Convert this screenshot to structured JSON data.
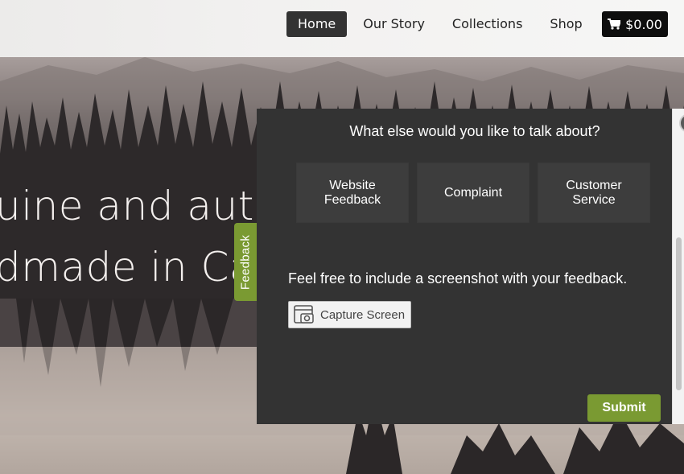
{
  "nav": {
    "items": [
      {
        "label": "Home",
        "active": true
      },
      {
        "label": "Our Story",
        "active": false
      },
      {
        "label": "Collections",
        "active": false
      },
      {
        "label": "Shop",
        "active": false
      }
    ],
    "cart": {
      "icon": "cart-icon",
      "total": "$0.00"
    }
  },
  "hero": {
    "line1": "uine and authe",
    "line2": "dmade in Cal"
  },
  "feedback_tab": {
    "label": "Feedback",
    "color": "#7a9a32"
  },
  "panel": {
    "question": "What else would you like to talk about?",
    "topics": [
      {
        "label": "Website\nFeedback"
      },
      {
        "label": "Complaint"
      },
      {
        "label": "Customer\nService"
      }
    ],
    "screenshot_hint": "Feel free to include a screenshot with your feedback.",
    "capture_label": "Capture Screen",
    "capture_icon": "camera-window-icon",
    "submit_label": "Submit",
    "background": "#333333",
    "accent": "#7a9a32"
  }
}
